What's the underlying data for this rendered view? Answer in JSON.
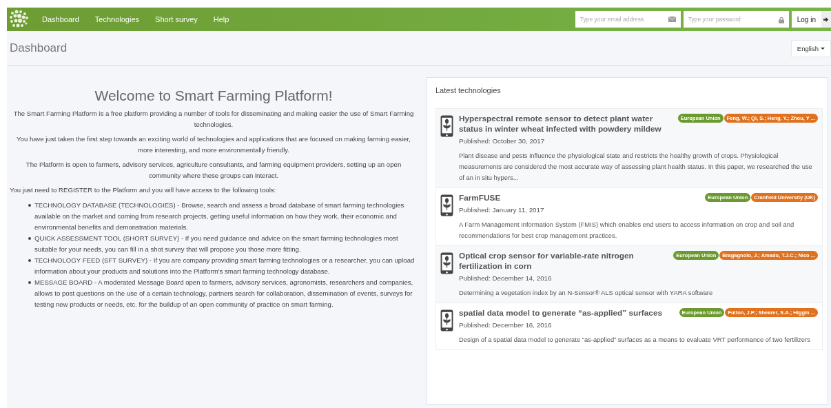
{
  "navbar": {
    "links": [
      {
        "label": "Dashboard"
      },
      {
        "label": "Technologies"
      },
      {
        "label": "Short survey"
      },
      {
        "label": "Help"
      }
    ],
    "email": {
      "placeholder": "Type your email address"
    },
    "password": {
      "placeholder": "Type your password"
    },
    "login_button": "Log in"
  },
  "page_title": "Dashboard",
  "language": "English",
  "welcome": {
    "title": "Welcome to Smart Farming Platform!",
    "paragraphs": [
      "The Smart Farming Platform is a free platform providing a number of tools for disseminating and making easier the use of Smart Farming technologies.",
      "You have just taken the first step towards an exciting world of technologies and applications that are focused on making farming easier, more interesting, and more environmentally friendly.",
      "The Platform is open to farmers, advisory services, agriculture consultants, and farming equipment providers, setting up an open community where these groups can interact."
    ],
    "intro": "You just need to REGISTER to the Platform and you will have access to the following tools:",
    "tools": [
      "TECHNOLOGY DATABASE (TECHNOLOGIES) - Browse, search and assess a broad database of smart farming technologies available on the market and coming from research projects, getting useful information on how they work, their economic and environmental benefits and demonstration materials.",
      "QUICK ASSESSMENT TOOL (SHORT SURVEY) - If you need guidance and advice on the smart farming technologies most suitable for your needs, you can fill in a shot survey that will propose you those more fitting.",
      "TECHNOLOGY FEED (SFT SURVEY) - If you are company providing smart farming technologies or a researcher, you can upload information about your products and solutions into the Platform's smart farming technology database.",
      "MESSAGE BOARD - A moderated Message Board open to farmers, advisory services, agronomists, researchers and companies, allows to post questions on the use of a certain technology, partners search for collaboration, dissemination of events, surveys for testing new products or needs, etc. for the buildup of an open community of practice on smart farming."
    ]
  },
  "latest": {
    "title": "Latest technologies",
    "items": [
      {
        "title": "Hyperspectral remote sensor to detect plant water status in winter wheat infected with powdery mildew",
        "published": "Published: October 30, 2017",
        "description": "Plant disease and pests influence the physiological state and restricts the healthy growth of crops. Physiological measurements are considered the most accurate way of assessing plant health status. In this paper, we researched the use of an in situ hypers...",
        "tags": [
          {
            "label": "European Union",
            "color": "#6b9a2e"
          },
          {
            "label": "Feng, W.; Qi, S.; Heng, Y.; Zhou, Y ...",
            "color": "#e2711d"
          }
        ]
      },
      {
        "title": "FarmFUSE",
        "published": "Published: January 11, 2017",
        "description": "A Farm Management Information System (FMIS) which enables end users to access information on crop and soil and recommendations for best crop management practices.",
        "tags": [
          {
            "label": "European Union",
            "color": "#6b9a2e"
          },
          {
            "label": "Cranfield University (UK)",
            "color": "#e2711d"
          }
        ]
      },
      {
        "title": "Optical crop sensor for variable-rate nitrogen fertilization in corn",
        "published": "Published: December 14, 2016",
        "description": "Determining a vegetation index by an N-Sensor® ALS optical sensor with YARA software",
        "tags": [
          {
            "label": "European Union",
            "color": "#6b9a2e"
          },
          {
            "label": "Bragagnolo, J.; Amado, T.J.C.; Nico ...",
            "color": "#e2711d"
          }
        ]
      },
      {
        "title": "spatial data model to generate “as-applied” surfaces",
        "published": "Published: December 16, 2016",
        "description": "Design of a spatial data model to generate “as-applied” surfaces as a means to evaluate VRT performance of two fertilizers",
        "tags": [
          {
            "label": "European Union",
            "color": "#6b9a2e"
          },
          {
            "label": "Fulton, J.P.; Shearer, S.A.; Higgin ...",
            "color": "#e2711d"
          }
        ]
      }
    ]
  }
}
